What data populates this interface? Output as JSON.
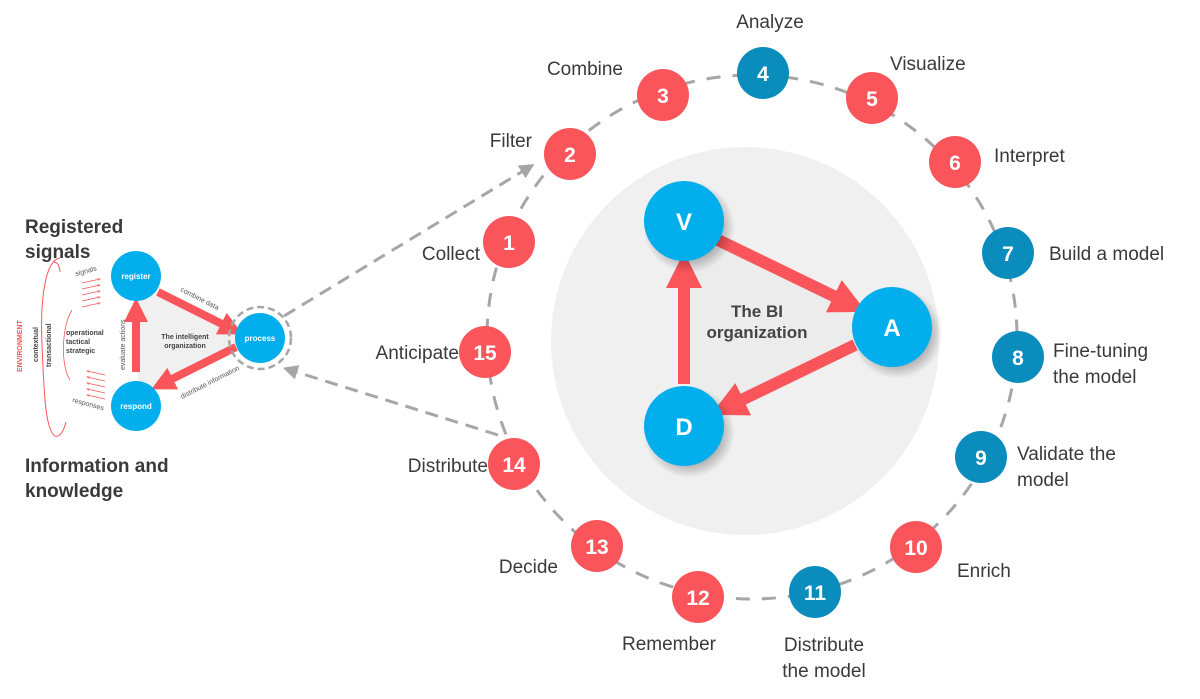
{
  "colors": {
    "red": "#f9555a",
    "dark_blue": "#0a8cbd",
    "light_blue": "#03aeed",
    "dash_grey": "#a6a6a6",
    "panel_grey": "#f0f0f0",
    "text": "#3a3a3a"
  },
  "left_diagram": {
    "heading_top": [
      "Registered",
      "signals"
    ],
    "heading_bottom": [
      "Information and",
      "knowledge"
    ],
    "environment_label": "ENVIRONMENT",
    "contextual_label": "contextual",
    "transactional_label": "transactional",
    "levels": [
      "operational",
      "tactical",
      "strategic"
    ],
    "signals_label": "signals",
    "responses_label": "responses",
    "center_label": [
      "The intelligent",
      "organization"
    ],
    "nodes": {
      "register": "register",
      "process": "process",
      "respond": "respond"
    },
    "edges": {
      "combine": "combine data",
      "distribute": "distribute information",
      "evaluate": "evaluate actions"
    }
  },
  "bi_core": {
    "center_label": [
      "The BI",
      "organization"
    ],
    "nodes": [
      "V",
      "A",
      "D"
    ]
  },
  "cycle_steps": [
    {
      "n": "1",
      "label": [
        "Collect"
      ],
      "color": "red"
    },
    {
      "n": "2",
      "label": [
        "Filter"
      ],
      "color": "red"
    },
    {
      "n": "3",
      "label": [
        "Combine"
      ],
      "color": "red"
    },
    {
      "n": "4",
      "label": [
        "Analyze"
      ],
      "color": "dark_blue"
    },
    {
      "n": "5",
      "label": [
        "Visualize"
      ],
      "color": "red"
    },
    {
      "n": "6",
      "label": [
        "Interpret"
      ],
      "color": "red"
    },
    {
      "n": "7",
      "label": [
        "Build a model"
      ],
      "color": "dark_blue"
    },
    {
      "n": "8",
      "label": [
        "Fine-tuning",
        "the model"
      ],
      "color": "dark_blue"
    },
    {
      "n": "9",
      "label": [
        "Validate the",
        "model"
      ],
      "color": "dark_blue"
    },
    {
      "n": "10",
      "label": [
        "Enrich"
      ],
      "color": "red"
    },
    {
      "n": "11",
      "label": [
        "Distribute",
        "the model"
      ],
      "color": "dark_blue"
    },
    {
      "n": "12",
      "label": [
        "Remember"
      ],
      "color": "red"
    },
    {
      "n": "13",
      "label": [
        "Decide"
      ],
      "color": "red"
    },
    {
      "n": "14",
      "label": [
        "Distribute"
      ],
      "color": "red"
    },
    {
      "n": "15",
      "label": [
        "Anticipate"
      ],
      "color": "red"
    }
  ]
}
